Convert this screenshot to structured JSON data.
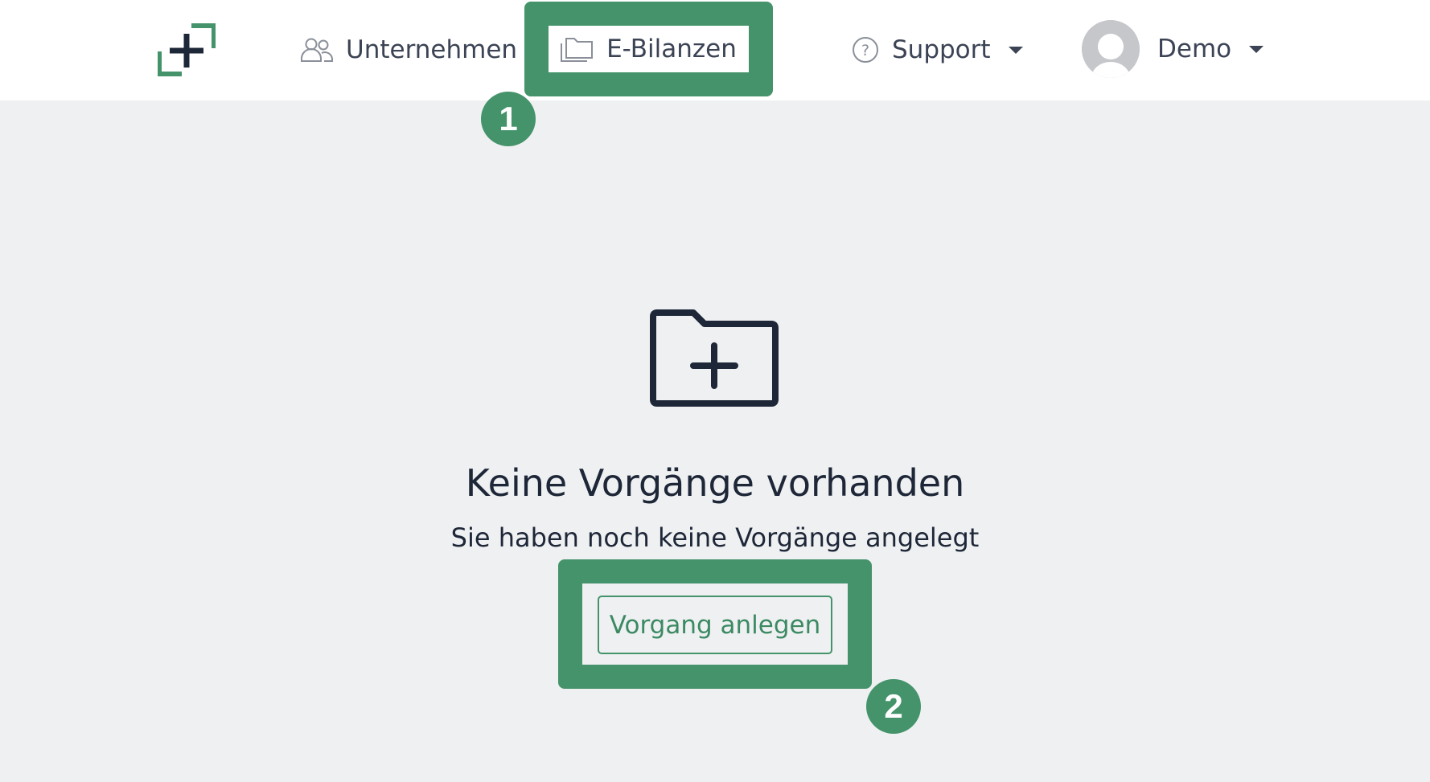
{
  "navbar": {
    "logo_icon": "plus-corner-logo",
    "items": [
      {
        "label": "Unternehmen",
        "icon": "users-icon"
      },
      {
        "label": "E-Bilanzen",
        "icon": "folders-icon"
      },
      {
        "label": "Support",
        "icon": "help-circle-icon"
      },
      {
        "label": "Demo",
        "icon": "avatar"
      }
    ]
  },
  "empty_state": {
    "icon": "folder-plus-icon",
    "title": "Keine Vorgänge vorhanden",
    "text": "Sie haben noch keine Vorgänge angelegt",
    "button_label": "Vorgang anlegen"
  },
  "annotations": [
    {
      "number": "1"
    },
    {
      "number": "2"
    }
  ],
  "colors": {
    "accent": "#44936a",
    "text": "#1e2738",
    "background": "#eff0f2",
    "navbar": "#ffffff"
  }
}
